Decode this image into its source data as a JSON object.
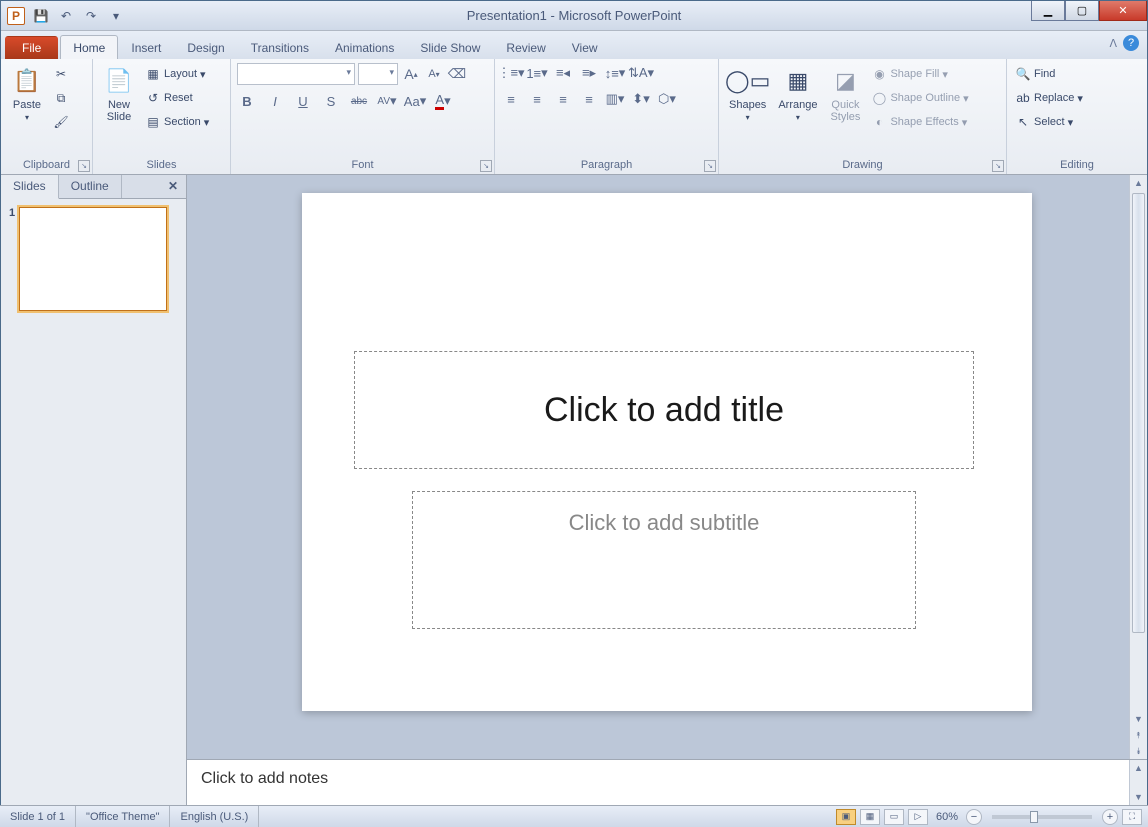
{
  "title": "Presentation1 - Microsoft PowerPoint",
  "qat": {
    "save": "💾",
    "undo": "↶",
    "redo": "↷",
    "dd": "▾"
  },
  "tabs": {
    "file": "File",
    "items": [
      "Home",
      "Insert",
      "Design",
      "Transitions",
      "Animations",
      "Slide Show",
      "Review",
      "View"
    ],
    "active": "Home"
  },
  "ribbon": {
    "clipboard": {
      "label": "Clipboard",
      "paste": "Paste",
      "cut": "",
      "copy": "",
      "fmt": ""
    },
    "slides": {
      "label": "Slides",
      "new_slide": "New\nSlide",
      "layout": "Layout",
      "reset": "Reset",
      "section": "Section"
    },
    "font": {
      "label": "Font",
      "b": "B",
      "i": "I",
      "u": "U",
      "s": "S",
      "strike": "abc",
      "av": "AV",
      "aa": "Aa",
      "color": "A"
    },
    "paragraph": {
      "label": "Paragraph"
    },
    "drawing": {
      "label": "Drawing",
      "shapes": "Shapes",
      "arrange": "Arrange",
      "quick": "Quick\nStyles",
      "fill": "Shape Fill",
      "outline": "Shape Outline",
      "effects": "Shape Effects"
    },
    "editing": {
      "label": "Editing",
      "find": "Find",
      "replace": "Replace",
      "select": "Select"
    }
  },
  "sidepane": {
    "slides_tab": "Slides",
    "outline_tab": "Outline",
    "close": "✕",
    "thumb_num": "1"
  },
  "slide": {
    "title_placeholder": "Click to add title",
    "subtitle_placeholder": "Click to add subtitle"
  },
  "notes": {
    "placeholder": "Click to add notes"
  },
  "status": {
    "slide": "Slide 1 of 1",
    "theme": "\"Office Theme\"",
    "lang": "English (U.S.)",
    "zoom": "60%"
  }
}
